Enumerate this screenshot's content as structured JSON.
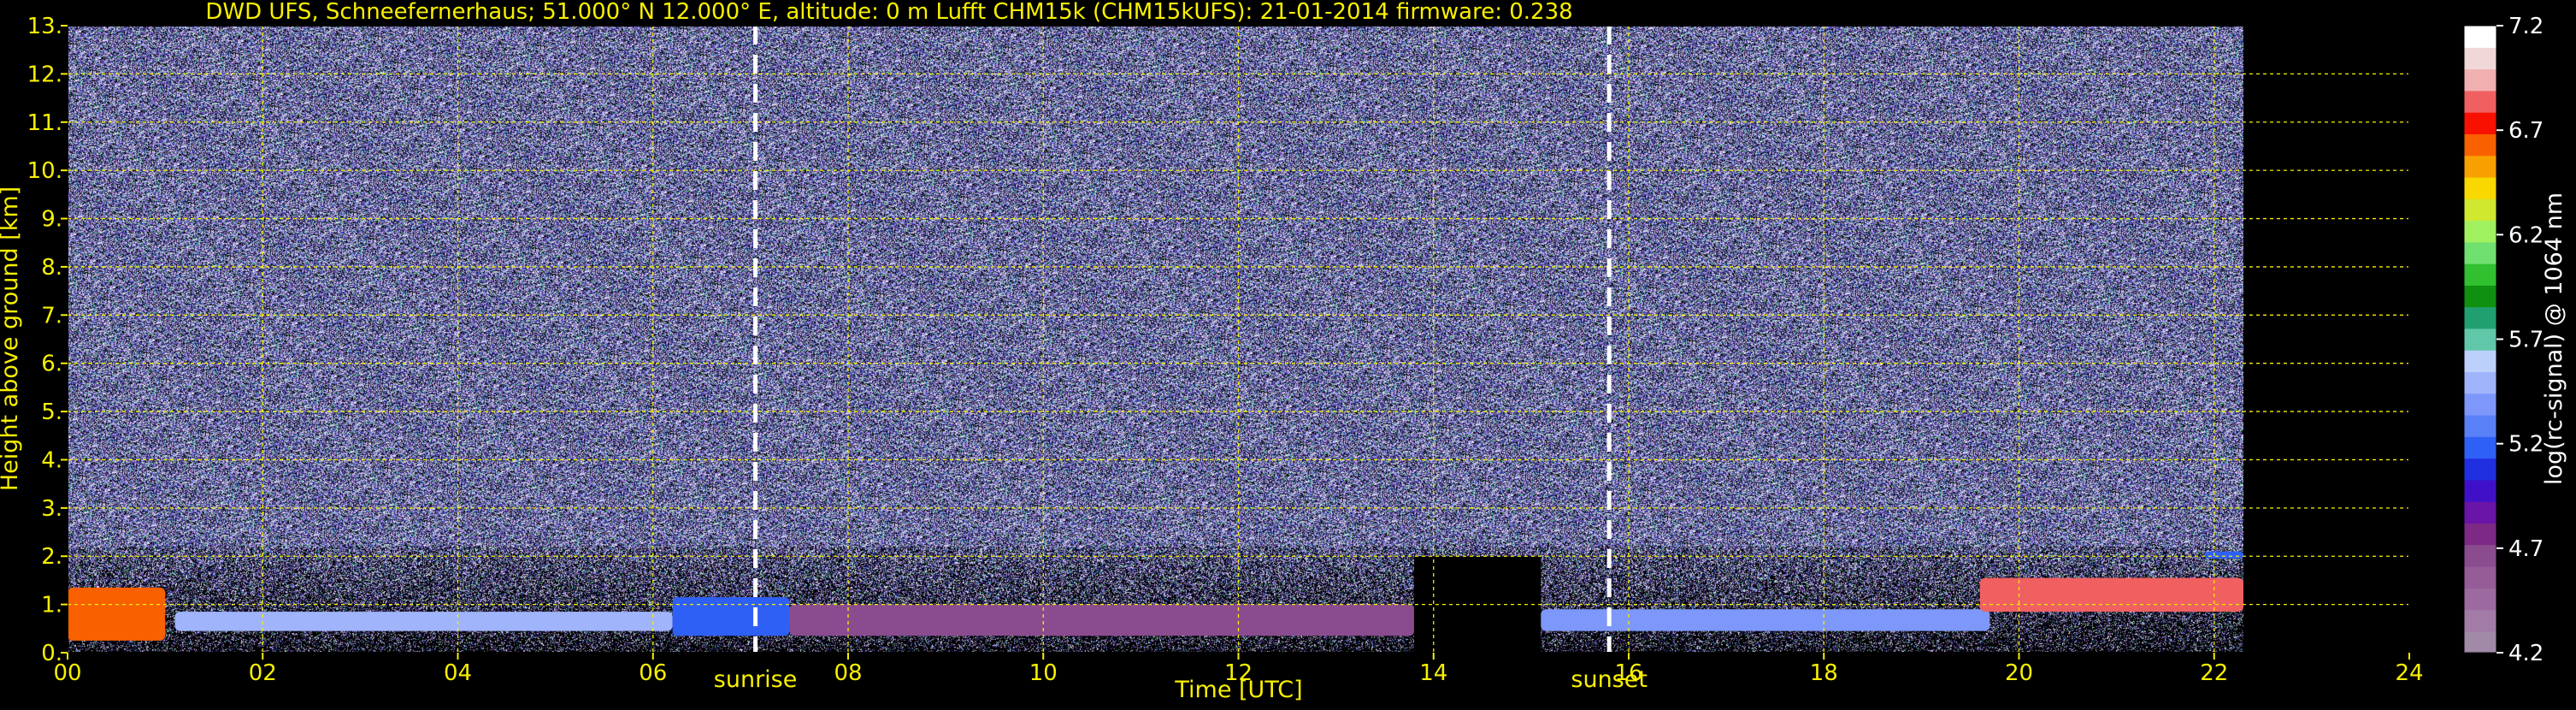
{
  "chart_data": {
    "type": "heatmap",
    "title": "DWD UFS, Schneefernerhaus; 51.000° N 12.000° E, altitude: 0 m    Lufft CHM15k (CHM15kUFS): 21-01-2014    firmware: 0.238",
    "xlabel": "Time [UTC]",
    "ylabel": "Height above ground [km]",
    "xlim": [
      0,
      24
    ],
    "ylim": [
      0,
      13
    ],
    "x_ticks": [
      "00",
      "02",
      "04",
      "06",
      "08",
      "10",
      "12",
      "14",
      "16",
      "18",
      "20",
      "22",
      "24"
    ],
    "y_ticks": [
      "0.",
      "1.",
      "2.",
      "3.",
      "4.",
      "5.",
      "6.",
      "7.",
      "8.",
      "9.",
      "10.",
      "11.",
      "12.",
      "13."
    ],
    "grid": true,
    "data_coverage_hours": [
      0,
      22.3
    ],
    "annotations": [
      {
        "label": "sunrise",
        "time": 7.05
      },
      {
        "label": "sunset",
        "time": 15.8
      }
    ],
    "colorbar": {
      "label": "log(rc-signal) @ 1064 nm",
      "range": [
        4.2,
        7.2
      ],
      "ticks": [
        "4.2",
        "4.7",
        "5.2",
        "5.7",
        "6.2",
        "6.7",
        "7.2"
      ],
      "colors": [
        "#a08aa8",
        "#a27ba6",
        "#9d6aa0",
        "#955c98",
        "#8a4c8e",
        "#7c2a86",
        "#6a14a8",
        "#4010c8",
        "#2030e0",
        "#2f60f5",
        "#5a80f8",
        "#7d98fa",
        "#a0b4fb",
        "#bcd0fb",
        "#60c8a8",
        "#20a070",
        "#109010",
        "#30c030",
        "#70e070",
        "#a0f060",
        "#d0e830",
        "#f8d800",
        "#f8a000",
        "#f86000",
        "#f81000",
        "#f06060",
        "#f0b0b0",
        "#f0d8d8",
        "#ffffff"
      ]
    },
    "layers": [
      {
        "name": "boundary layer",
        "start": 0.0,
        "end": 1.0,
        "base_km": 0.25,
        "top_km": 1.35,
        "level": 6.6
      },
      {
        "name": "boundary layer",
        "start": 1.1,
        "end": 6.2,
        "base_km": 0.45,
        "top_km": 0.85,
        "level": 5.5
      },
      {
        "name": "boundary layer",
        "start": 6.2,
        "end": 7.4,
        "base_km": 0.35,
        "top_km": 1.15,
        "level": 5.2
      },
      {
        "name": "boundary layer",
        "start": 7.4,
        "end": 13.8,
        "base_km": 0.35,
        "top_km": 1.0,
        "level": 4.7
      },
      {
        "name": "boundary layer",
        "start": 15.1,
        "end": 19.7,
        "base_km": 0.45,
        "top_km": 0.9,
        "level": 5.4
      },
      {
        "name": "elevated layer",
        "start": 19.6,
        "end": 22.3,
        "base_km": 0.85,
        "top_km": 1.55,
        "level": 6.8
      },
      {
        "name": "elevated layer",
        "start": 21.9,
        "end": 22.3,
        "base_km": 1.95,
        "top_km": 2.1,
        "level": 5.2
      }
    ],
    "noise_level": 4.4
  }
}
